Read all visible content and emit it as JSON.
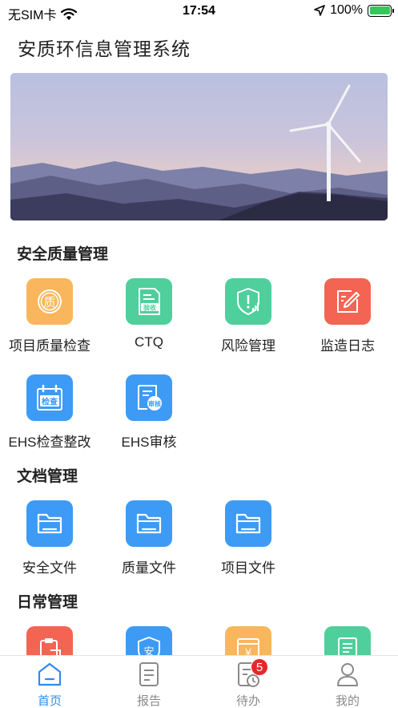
{
  "status": {
    "carrier": "无SIM卡",
    "time": "17:54",
    "battery": "100%"
  },
  "app": {
    "title": "安质环信息管理系统"
  },
  "sections": {
    "quality": {
      "title": "安全质量管理",
      "items": [
        {
          "label": "项目质量检查",
          "icon": "quality-badge-icon",
          "color": "#f9b65c"
        },
        {
          "label": "CTQ",
          "icon": "acceptance-doc-icon",
          "color": "#4fcf9c"
        },
        {
          "label": "风险管理",
          "icon": "risk-shield-icon",
          "color": "#4fcf9c"
        },
        {
          "label": "监造日志",
          "icon": "edit-log-icon",
          "color": "#f46453"
        },
        {
          "label": "EHS检查整改",
          "icon": "inspection-calendar-icon",
          "color": "#3d9bf5"
        },
        {
          "label": "EHS审核",
          "icon": "audit-doc-icon",
          "color": "#3d9bf5"
        }
      ],
      "icon_text": {
        "quality": "质",
        "ctq": "验收",
        "inspect": "检查",
        "audit": "审核"
      }
    },
    "docs": {
      "title": "文档管理",
      "items": [
        {
          "label": "安全文件",
          "icon": "folder-icon",
          "color": "#3d9bf5"
        },
        {
          "label": "质量文件",
          "icon": "folder-icon",
          "color": "#3d9bf5"
        },
        {
          "label": "项目文件",
          "icon": "folder-icon",
          "color": "#3d9bf5"
        }
      ]
    },
    "daily": {
      "title": "日常管理",
      "items": [
        {
          "icon": "clipboard-hand-icon",
          "color": "#f46453"
        },
        {
          "icon": "safety-shield-icon",
          "color": "#3d9bf5",
          "text": "安"
        },
        {
          "icon": "expense-doc-icon",
          "color": "#f9b65c",
          "text": "¥"
        },
        {
          "icon": "report-doc-icon",
          "color": "#4fcf9c"
        }
      ]
    }
  },
  "tabbar": {
    "tabs": [
      {
        "label": "首页",
        "icon": "home-icon",
        "active": true
      },
      {
        "label": "报告",
        "icon": "report-icon"
      },
      {
        "label": "待办",
        "icon": "todo-icon",
        "badge": "5"
      },
      {
        "label": "我的",
        "icon": "profile-icon"
      }
    ]
  },
  "colors": {
    "accent": "#2e8bf0",
    "inactive": "#8a8a8a",
    "badge": "#e8262a"
  }
}
